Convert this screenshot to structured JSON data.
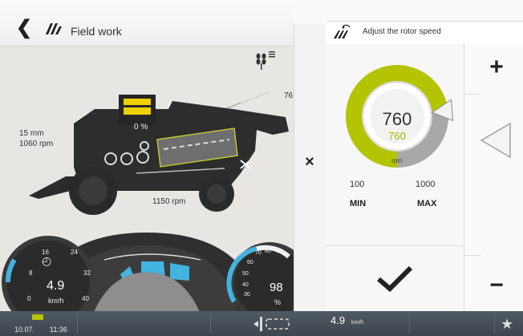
{
  "header": {
    "title": "Field work"
  },
  "machine": {
    "cutter_height": "15 mm",
    "reel_rpm": "1060 rpm",
    "grain_tank": "0 %",
    "rotor_rpm": "1150 rpm",
    "partial_label": "76"
  },
  "dashboard": {
    "speed_value": "4.9",
    "speed_unit": "km/h",
    "speed_ticks": [
      "16",
      "24",
      "8",
      "32",
      "0",
      "40"
    ],
    "right_value": "98",
    "right_unit": "%",
    "right_ticks": [
      "70",
      "80",
      "90",
      "60",
      "50",
      "40",
      "30"
    ]
  },
  "adjust": {
    "title": "Adjust the rotor speed",
    "current_value": "760",
    "target_value": "760",
    "unit": "rpm",
    "min_value": "100",
    "max_value": "1000",
    "min_label": "MIN",
    "max_label": "MAX",
    "level": 0.73,
    "colors": {
      "accent": "#b5c400",
      "gray": "#a8a8a8"
    }
  },
  "buttons": {
    "plus": "+",
    "minus": "−",
    "close": "×",
    "confirm": "✔"
  },
  "footer": {
    "date": "10.07.",
    "time": "11:36",
    "speed": "4.9",
    "speed_unit": "km/h"
  }
}
